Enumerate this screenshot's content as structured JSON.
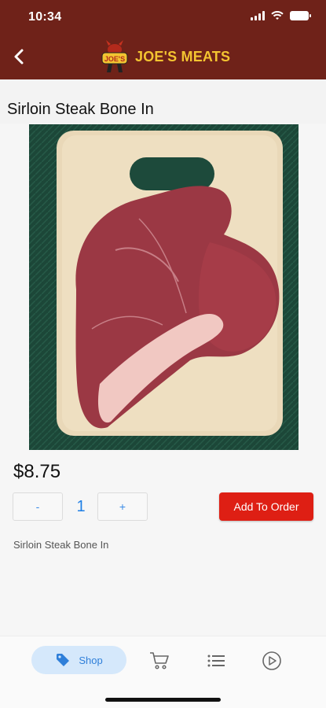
{
  "status_bar": {
    "time": "10:34"
  },
  "header": {
    "brand": "JOE'S MEATS",
    "logo_text": "JOE'S"
  },
  "product": {
    "title": "Sirloin Steak Bone In",
    "price": "$8.75",
    "quantity": "1",
    "minus_label": "-",
    "plus_label": "+",
    "add_label": "Add To Order",
    "description": "Sirloin Steak Bone In"
  },
  "tabbar": {
    "items": [
      {
        "label": "Shop",
        "icon": "tag-icon",
        "active": true
      },
      {
        "label": "",
        "icon": "cart-icon",
        "active": false
      },
      {
        "label": "",
        "icon": "list-icon",
        "active": false
      },
      {
        "label": "",
        "icon": "play-circle-icon",
        "active": false
      }
    ]
  },
  "colors": {
    "header_bg": "#6f2219",
    "brand_yellow": "#f3c431",
    "add_button": "#de1f14",
    "accent_blue": "#1f7fe5"
  }
}
